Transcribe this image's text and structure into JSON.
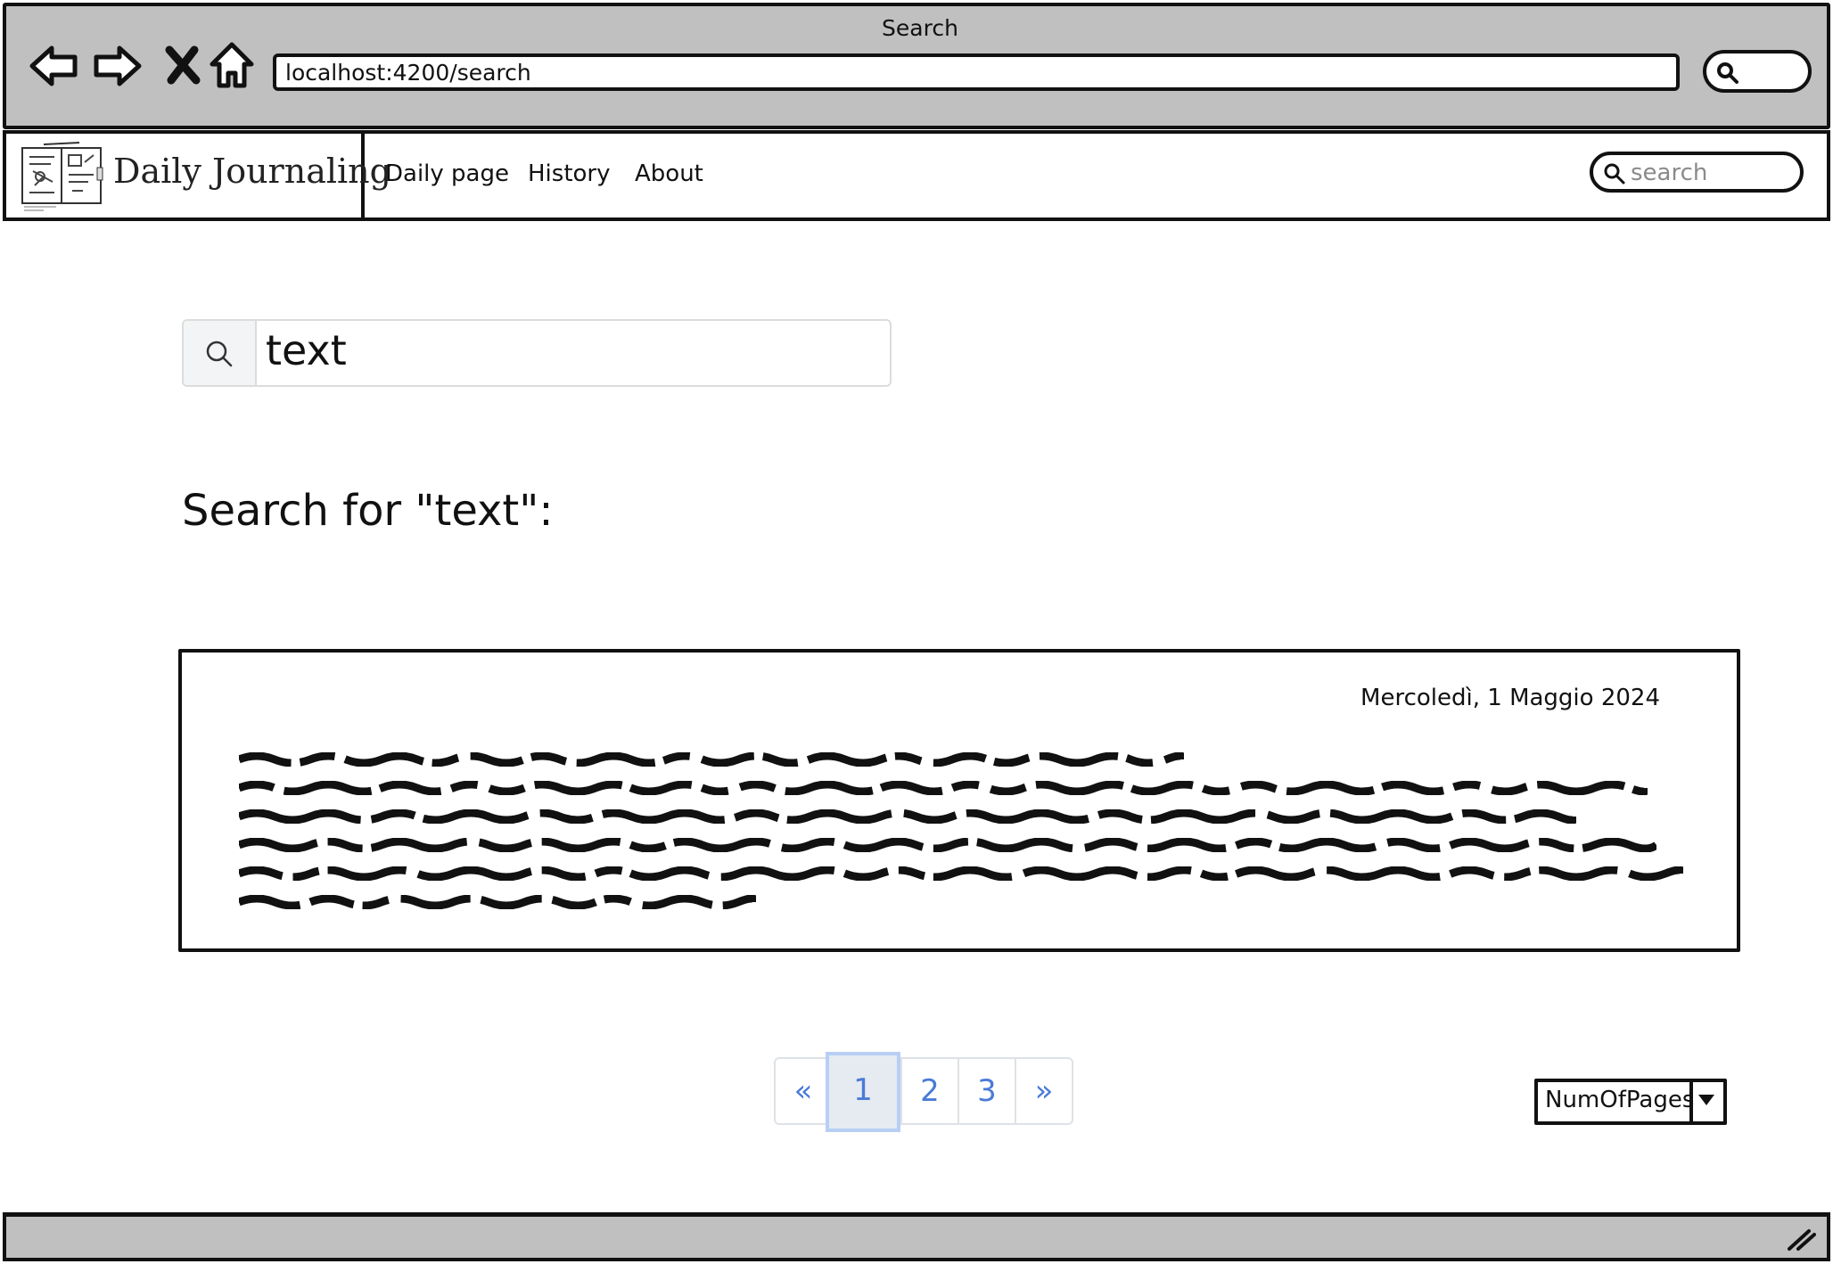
{
  "browser": {
    "title": "Search",
    "url": "localhost:4200/search"
  },
  "app": {
    "logo_text": "Daily Journaling",
    "nav": {
      "links": [
        "Daily page",
        "History",
        "About"
      ],
      "search_placeholder": "search"
    }
  },
  "search": {
    "value": "text",
    "results_heading": "Search for \"text\":"
  },
  "results": [
    {
      "date": "Mercoledì, 1 Maggio 2024"
    }
  ],
  "pagination": {
    "prev": "«",
    "pages": [
      "1",
      "2",
      "3"
    ],
    "next": "»",
    "active_page": "1"
  },
  "page_size_select": {
    "label": "NumOfPages"
  },
  "colors": {
    "chrome": "#c0c0c0",
    "link": "#4a7bd6",
    "active_page_bg": "#e6eaf1"
  },
  "icons": {
    "back": "back-arrow-icon",
    "forward": "forward-arrow-icon",
    "stop": "close-icon",
    "home": "home-icon",
    "search": "search-icon",
    "dropdown": "chevron-down-icon",
    "resize": "resize-grip-icon"
  }
}
